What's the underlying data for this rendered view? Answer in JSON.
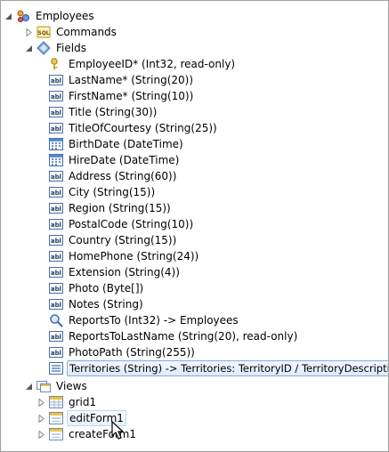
{
  "tree": {
    "root": {
      "label": "Employees",
      "icon": "data-controller-icon"
    },
    "commands": {
      "label": "Commands",
      "icon": "sql-command-icon"
    },
    "fields": {
      "label": "Fields",
      "icon": "fields-icon",
      "items": [
        {
          "label": "EmployeeID* (Int32, read-only)",
          "icon": "key-icon"
        },
        {
          "label": "LastName* (String(20))",
          "icon": "text-field-icon"
        },
        {
          "label": "FirstName* (String(10))",
          "icon": "text-field-icon"
        },
        {
          "label": "Title (String(30))",
          "icon": "text-field-icon"
        },
        {
          "label": "TitleOfCourtesy (String(25))",
          "icon": "text-field-icon"
        },
        {
          "label": "BirthDate (DateTime)",
          "icon": "calendar-icon"
        },
        {
          "label": "HireDate (DateTime)",
          "icon": "calendar-icon"
        },
        {
          "label": "Address (String(60))",
          "icon": "text-field-icon"
        },
        {
          "label": "City (String(15))",
          "icon": "text-field-icon"
        },
        {
          "label": "Region (String(15))",
          "icon": "text-field-icon"
        },
        {
          "label": "PostalCode (String(10))",
          "icon": "text-field-icon"
        },
        {
          "label": "Country (String(15))",
          "icon": "text-field-icon"
        },
        {
          "label": "HomePhone (String(24))",
          "icon": "text-field-icon"
        },
        {
          "label": "Extension (String(4))",
          "icon": "text-field-icon"
        },
        {
          "label": "Photo (Byte[])",
          "icon": "text-field-icon"
        },
        {
          "label": "Notes (String)",
          "icon": "text-field-icon"
        },
        {
          "label": "ReportsTo (Int32) -> Employees",
          "icon": "lookup-icon"
        },
        {
          "label": "ReportsToLastName (String(20), read-only)",
          "icon": "text-field-icon"
        },
        {
          "label": "PhotoPath (String(255))",
          "icon": "text-field-icon"
        },
        {
          "label": "Territories (String) -> Territories: TerritoryID / TerritoryDescription",
          "icon": "list-icon",
          "selected": true
        }
      ]
    },
    "views": {
      "label": "Views",
      "icon": "views-icon",
      "items": [
        {
          "label": "grid1",
          "icon": "grid-view-icon"
        },
        {
          "label": "editForm1",
          "icon": "form-view-icon",
          "hovered": true
        },
        {
          "label": "createForm1",
          "icon": "form-view-icon"
        }
      ]
    }
  },
  "colors": {
    "selection_border": "#84acdd",
    "hover_border": "#b8d6fb"
  }
}
